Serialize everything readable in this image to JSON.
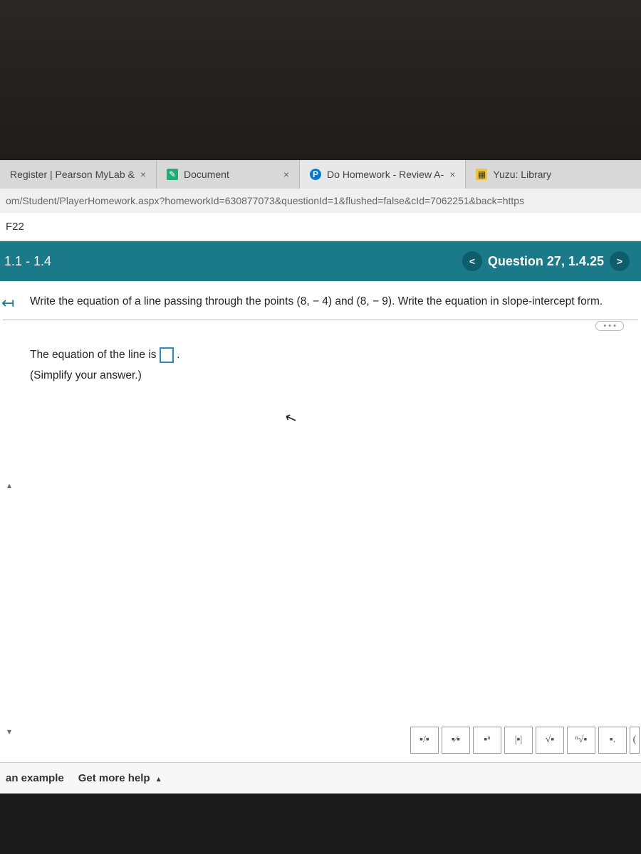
{
  "tabs": {
    "tab1": {
      "label": "Register | Pearson MyLab &"
    },
    "tab2": {
      "label": "Document"
    },
    "tab3": {
      "label": "Do Homework - Review A-"
    },
    "tab4": {
      "label": "Yuzu: Library"
    }
  },
  "url": "om/Student/PlayerHomework.aspx?homeworkId=630877073&questionId=1&flushed=false&cId=7062251&back=https",
  "page_header": "F22",
  "section": {
    "range": "1.1 - 1.4",
    "question_label": "Question 27, 1.4.25"
  },
  "prompt": "Write the equation of a line passing through the points (8, − 4) and (8, − 9). Write the equation in slope-intercept form.",
  "answer": {
    "prefix": "The equation of the line is ",
    "suffix": ".",
    "simplify": "(Simplify your answer.)"
  },
  "more_dots": "• • •",
  "tools": {
    "frac": "▪/▪",
    "mixed": "▪⁄▪",
    "exp": "▪ⁿ",
    "abs": "|▪|",
    "sqrt": "√▪",
    "nroot": "ⁿ√▪",
    "sub": "▪."
  },
  "footer": {
    "example": "an example",
    "more_help": "Get more help"
  }
}
